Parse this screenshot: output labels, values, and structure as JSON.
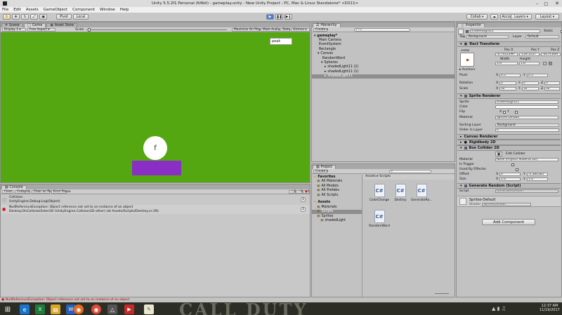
{
  "window": {
    "title": "Unity 5.5.2f1 Personal (64bit) - gameplay.unity - New Unity Project - PC, Mac & Linux Standalone* <DX11>"
  },
  "menu": [
    "File",
    "Edit",
    "Assets",
    "GameObject",
    "Component",
    "Window",
    "Help"
  ],
  "toolbar": {
    "pivot": "Pivot",
    "local": "Local",
    "collab": "Collab",
    "account": "Account",
    "layers": "Layers",
    "layout": "Layout"
  },
  "tabs": {
    "scene": "Scene",
    "game": "Game",
    "asset_store": "Asset Store"
  },
  "game_bar": {
    "display": "Display 1",
    "aspect": "Free Aspect",
    "scale_label": "Scale",
    "maximize": "Maximize On Play",
    "mute": "Mute Audio",
    "stats": "Stats",
    "gizmos": "Gizmos"
  },
  "game_view": {
    "bg_color": "#55a711",
    "ball_text": "f",
    "peak_text": "peak",
    "bar_color": "#8a2fc5"
  },
  "console": {
    "tab": "Console",
    "buttons": [
      "Clear",
      "Collapse",
      "Clear on Play",
      "Error Pause"
    ],
    "counts": [
      "2",
      "0",
      "1"
    ],
    "entries": [
      {
        "line1": "Collision",
        "line2": "UnityEngine.Debug:Log(Object)",
        "count": "1",
        "kind": "info"
      },
      {
        "line1": "NullReferenceException: Object reference not set to an instance of an object",
        "line2": "Destroy.OnCollisionEnter2D (UnityEngine.Collision2D other) (at Assets/Scripts/Destroy.cs:39)",
        "count": "1",
        "kind": "error"
      }
    ]
  },
  "status_bar": {
    "text": "NullReferenceException: Object reference not set to an instance of an object"
  },
  "hierarchy": {
    "tab": "Hierarchy",
    "create": "Create",
    "search_placeholder": "All",
    "items": [
      {
        "label": "gameplay*",
        "depth": 0,
        "selected": false
      },
      {
        "label": "Main Camera",
        "depth": 1,
        "selected": false
      },
      {
        "label": "EventSystem",
        "depth": 1,
        "selected": false
      },
      {
        "label": "Rectangle",
        "depth": 1,
        "selected": false
      },
      {
        "label": "Canvas",
        "depth": 1,
        "selected": false
      },
      {
        "label": "RandomWord",
        "depth": 2,
        "selected": false
      },
      {
        "label": "Spheres",
        "depth": 2,
        "selected": false
      },
      {
        "label": "shadedLight11 (2)",
        "depth": 3,
        "selected": false
      },
      {
        "label": "shadedLight11 (1)",
        "depth": 3,
        "selected": false
      },
      {
        "label": "shadedLight11",
        "depth": 3,
        "selected": true
      }
    ]
  },
  "project": {
    "tab": "Project",
    "create": "Create",
    "tree": [
      {
        "label": "Favorites",
        "depth": 0,
        "bold": true
      },
      {
        "label": "All Materials",
        "depth": 1,
        "bold": false
      },
      {
        "label": "All Models",
        "depth": 1,
        "bold": false
      },
      {
        "label": "All Prefabs",
        "depth": 1,
        "bold": false
      },
      {
        "label": "All Scripts",
        "depth": 1,
        "bold": false
      },
      {
        "label": "Assets",
        "depth": 0,
        "bold": true
      },
      {
        "label": "Materials",
        "depth": 1,
        "bold": false
      },
      {
        "label": "Scripts",
        "depth": 1,
        "bold": false
      },
      {
        "label": "Sprites",
        "depth": 1,
        "bold": false
      },
      {
        "label": "shadedLight",
        "depth": 2,
        "bold": false
      }
    ],
    "breadcrumb": "Assets ▸ Scripts",
    "files": [
      "ColorChange",
      "Destroy",
      "GenerateRa...",
      "RandomWord"
    ]
  },
  "inspector": {
    "tab": "Inspector",
    "object_name": "shadedLight11",
    "static_label": "Static",
    "tag_label": "Tag",
    "tag_value": "Background",
    "layer_label": "Layer",
    "layer_value": "Default",
    "rect_transform": {
      "title": "Rect Transform",
      "anchor_label": "center",
      "pos_x_label": "Pos X",
      "pos_y_label": "Pos Y",
      "pos_z_label": "Pos Z",
      "pos_x": "-6.793139e-",
      "pos_y": "-139.1057",
      "pos_z": "-4679.899",
      "width_label": "Width",
      "height_label": "Height",
      "width": "1.6",
      "height": "1.6",
      "anchors": "Anchors",
      "pivot_label": "Pivot",
      "pivot_x": "0.5",
      "pivot_y": "0.5",
      "rotation_label": "Rotation",
      "rot_x": "0",
      "rot_y": "0",
      "rot_z": "0",
      "scale_label": "Scale",
      "scale_x": "52",
      "scale_y": "52",
      "scale_z": "52",
      "x": "X",
      "y": "Y",
      "z": "Z"
    },
    "sprite_renderer": {
      "title": "Sprite Renderer",
      "sprite_label": "Sprite",
      "sprite": "shadedLight11",
      "color_label": "Color",
      "flip_label": "Flip",
      "flip_x": "X",
      "flip_y": "Y",
      "material_label": "Material",
      "material": "Sprites-Default",
      "sorting_label": "Sorting Layer",
      "sorting": "Background",
      "order_label": "Order in Layer",
      "order": "0"
    },
    "canvas_renderer": {
      "title": "Canvas Renderer"
    },
    "rigidbody": {
      "title": "Rigidbody 2D"
    },
    "box_collider": {
      "title": "Box Collider 2D",
      "edit_collider": "Edit Collider",
      "material_label": "Material",
      "material": "None (Physics Material 2D)",
      "trigger_label": "Is Trigger",
      "effector_label": "Used By Effector",
      "offset_label": "Offset",
      "offset_x": "0",
      "offset_y": "-2.384185",
      "size_label": "Size",
      "size_x": "1.6",
      "size_y": "1.6"
    },
    "generate_random": {
      "title": "Generate Random (Script)",
      "script_label": "Script",
      "script": "GenerateRandom"
    },
    "material_preview": {
      "name": "Sprites-Default",
      "shader_label": "Shader",
      "shader": "Sprites/Default"
    },
    "add_component": "Add Component"
  },
  "taskbar": {
    "time": "12:37 AM",
    "date": "11/19/2017",
    "wallpaper_text": "CALL DUTY"
  }
}
